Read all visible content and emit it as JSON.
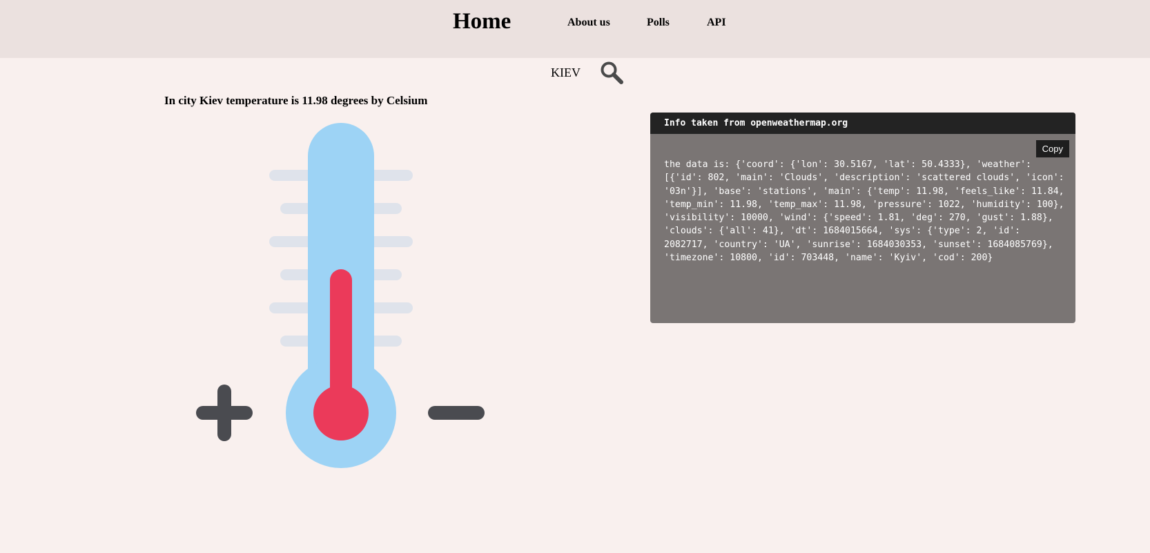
{
  "nav": {
    "home": "Home",
    "about": "About us",
    "polls": "Polls",
    "api": "API"
  },
  "search": {
    "value": "KIEV",
    "icon": "search-icon"
  },
  "main": {
    "heading": "In city Kiev temperature is 11.98 degrees by Celsium",
    "thermometer_icon": "thermometer-icon"
  },
  "info": {
    "header": "Info taken from openweathermap.org",
    "copy_label": "Copy",
    "text": "the data is: {'coord': {'lon': 30.5167, 'lat': 50.4333}, 'weather': [{'id': 802, 'main': 'Clouds', 'description': 'scattered clouds', 'icon': '03n'}], 'base': 'stations', 'main': {'temp': 11.98, 'feels_like': 11.84, 'temp_min': 11.98, 'temp_max': 11.98, 'pressure': 1022, 'humidity': 100}, 'visibility': 10000, 'wind': {'speed': 1.81, 'deg': 270, 'gust': 1.88}, 'clouds': {'all': 41}, 'dt': 1684015664, 'sys': {'type': 2, 'id': 2082717, 'country': 'UA', 'sunrise': 1684030353, 'sunset': 1684085769}, 'timezone': 10800, 'id': 703448, 'name': 'Kyiv', 'cod': 200}"
  },
  "colors": {
    "page_bg": "#f9f0ee",
    "nav_bg": "#ebe1df",
    "code_bg": "#7a7574",
    "code_header_bg": "#232323",
    "thermo_tube": "#9dd3f5",
    "thermo_mercury": "#eb3a5a",
    "thermo_ticks": "#dfe3eb",
    "thermo_signs": "#4a4b50"
  }
}
